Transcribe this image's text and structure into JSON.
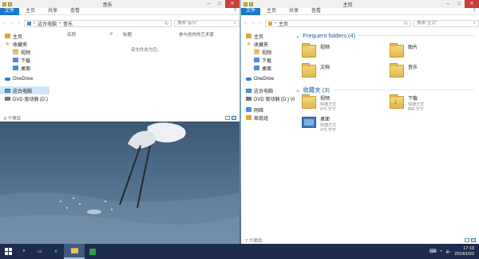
{
  "left_window": {
    "title": "音乐",
    "ribbon": {
      "file": "文件",
      "tabs": [
        "主页",
        "共享",
        "查看"
      ]
    },
    "address": {
      "path": [
        "这台电脑",
        "音乐"
      ],
      "search_placeholder": "搜索\"音乐\""
    },
    "nav": [
      {
        "label": "主页",
        "icon": "home-icon",
        "level": 0
      },
      {
        "label": "收藏夹",
        "icon": "star-icon",
        "level": 0
      },
      {
        "label": "视频",
        "icon": "folder-icon",
        "level": 1
      },
      {
        "label": "下载",
        "icon": "download-icon",
        "level": 1
      },
      {
        "label": "桌面",
        "icon": "desktop-icon",
        "level": 1
      },
      {
        "label": "OneDrive",
        "icon": "cloud-icon",
        "level": 0
      },
      {
        "label": "这台电脑",
        "icon": "pc-icon",
        "level": 0,
        "selected": true
      },
      {
        "label": "DVD 驱动器 (D:)",
        "icon": "dvd-icon",
        "level": 0
      }
    ],
    "columns": [
      "名称",
      "#",
      "标题",
      "参与创作的艺术家"
    ],
    "empty_message": "该文件夹为空。",
    "status": "0 个项目"
  },
  "right_window": {
    "title": "主页",
    "ribbon": {
      "file": "文件",
      "tabs": [
        "主页",
        "共享",
        "查看"
      ]
    },
    "address": {
      "path": [
        "主页"
      ],
      "search_placeholder": "搜索\"主页\""
    },
    "nav": [
      {
        "label": "主页",
        "icon": "home-icon",
        "level": 0
      },
      {
        "label": "收藏夹",
        "icon": "star-icon",
        "level": 0
      },
      {
        "label": "视频",
        "icon": "folder-icon",
        "level": 1
      },
      {
        "label": "下载",
        "icon": "download-icon",
        "level": 1
      },
      {
        "label": "桌面",
        "icon": "desktop-icon",
        "level": 1
      },
      {
        "label": "OneDrive",
        "icon": "cloud-icon",
        "level": 0
      },
      {
        "label": "这台电脑",
        "icon": "pc-icon",
        "level": 0
      },
      {
        "label": "DVD 驱动器 (D:) VI",
        "icon": "dvd-icon",
        "level": 0
      },
      {
        "label": "网络",
        "icon": "network-icon",
        "level": 0
      },
      {
        "label": "家庭组",
        "icon": "homegroup-icon",
        "level": 0
      }
    ],
    "frequent_header": "Frequent folders (4)",
    "frequent": [
      "视频",
      "图片",
      "文档",
      "音乐"
    ],
    "favorites_header": "收藏夹 (3)",
    "favorites": [
      {
        "name": "视频",
        "type": "快捷方式",
        "size": "875 字节"
      },
      {
        "name": "下载",
        "type": "快捷方式",
        "size": "892 字节"
      },
      {
        "name": "桌面",
        "type": "快捷方式",
        "size": "475 字节"
      }
    ],
    "status": "7 个项目"
  },
  "taskbar": {
    "buttons": [
      "start-button",
      "search-button",
      "task-view-button",
      "ie-button",
      "explorer-button",
      "store-button"
    ],
    "time": "17:10",
    "date": "2014/10/2"
  },
  "colors": {
    "accent": "#1979ca",
    "taskbar": "#1d2c4c",
    "folder": "#e2b84a"
  }
}
